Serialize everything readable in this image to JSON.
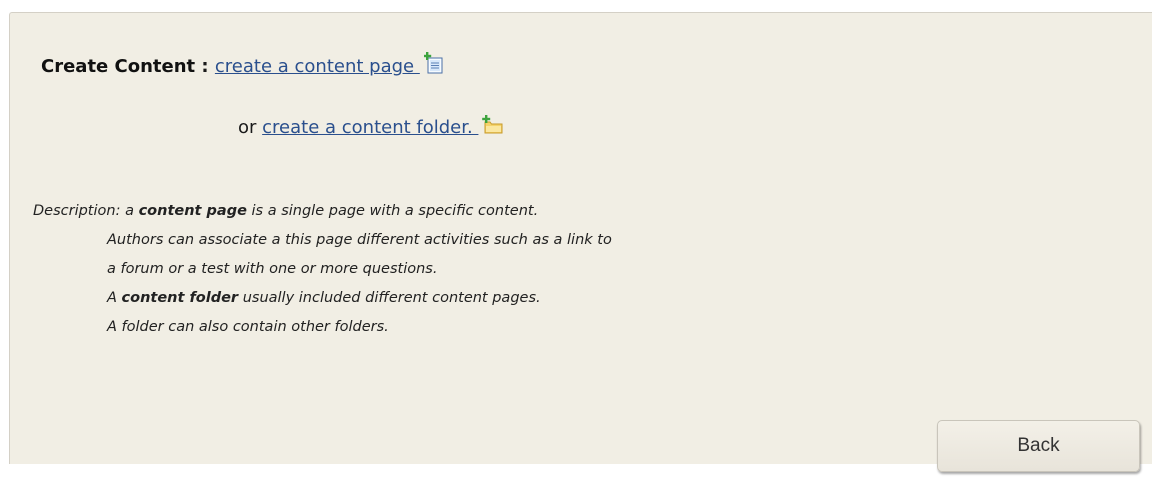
{
  "create": {
    "label": "Create Content",
    "separator": " : ",
    "page_link": "create a content page ",
    "or_text": "or ",
    "folder_link": "create a content folder. "
  },
  "icons": {
    "page": "new-page-icon",
    "folder": "new-folder-icon"
  },
  "description": {
    "prefix": "Description: a ",
    "page_term": "content page",
    "line1_rest": " is a single page with a specific content.",
    "line2": "Authors can associate a this page different activities such as a link to",
    "line3": "a forum or a test with one or more questions.",
    "line4_prefix": "A ",
    "folder_term": "content folder",
    "line4_rest": " usually included different content pages.",
    "line5": "A folder can also contain other folders."
  },
  "buttons": {
    "back": "Back"
  },
  "colors": {
    "panel_bg": "#f1eee4",
    "link": "#2a4f8d"
  }
}
